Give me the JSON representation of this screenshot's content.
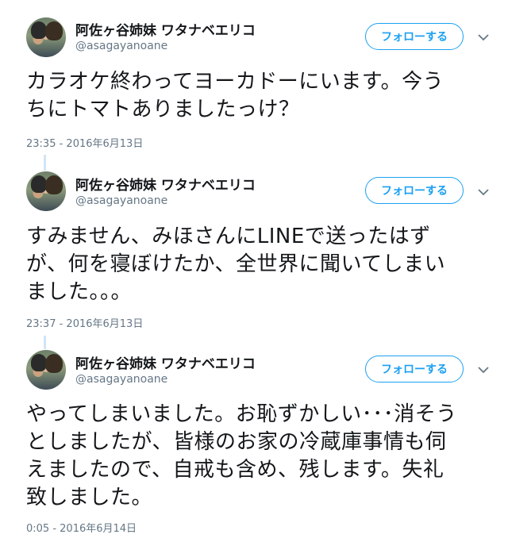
{
  "follow_label": "フォローする",
  "accent_color": "#1da1f2",
  "tweets": [
    {
      "author_name": "阿佐ヶ谷姉妹 ワタナベエリコ",
      "author_handle": "@asagayanoane",
      "lines": [
        "カラオケ終わってヨーカドーにいます。今う",
        "ちにトマトありましたっけ？"
      ],
      "timestamp": "23:35 - 2016年6月13日"
    },
    {
      "author_name": "阿佐ヶ谷姉妹 ワタナベエリコ",
      "author_handle": "@asagayanoane",
      "lines": [
        "すみません、みほさんにLINEで送ったはず",
        "が、何を寝ぼけたか、全世界に聞いてしまい",
        "ました。。。"
      ],
      "timestamp": "23:37 - 2016年6月13日"
    },
    {
      "author_name": "阿佐ヶ谷姉妹 ワタナベエリコ",
      "author_handle": "@asagayanoane",
      "lines": [
        "やってしまいました。お恥ずかしい･･･消そう",
        "としましたが、皆様のお家の冷蔵庫事情も伺",
        "えましたので、自戒も含め、残します。失礼",
        "致しました。"
      ],
      "timestamp": "0:05 - 2016年6月14日"
    }
  ]
}
